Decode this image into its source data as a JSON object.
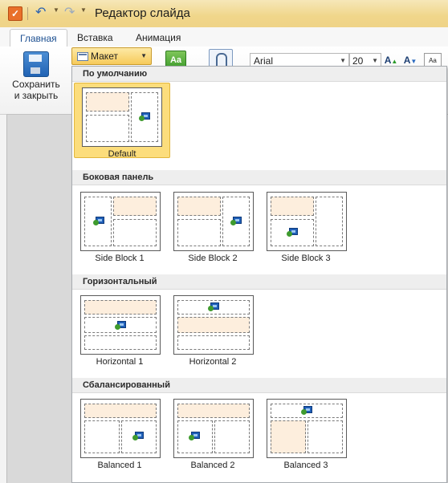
{
  "window": {
    "title": "Редактор слайда"
  },
  "tabs": [
    "Главная",
    "Вставка",
    "Анимация"
  ],
  "ribbon": {
    "save_label_1": "Сохранить",
    "save_label_2": "и закрыть",
    "layout_button": "Макет",
    "font": "Arial",
    "font_size": "20"
  },
  "sections": [
    {
      "title": "По умолчанию",
      "items": [
        {
          "label": "Default",
          "selected": true
        }
      ]
    },
    {
      "title": "Боковая панель",
      "items": [
        {
          "label": "Side Block 1"
        },
        {
          "label": "Side Block 2"
        },
        {
          "label": "Side Block 3"
        }
      ]
    },
    {
      "title": "Горизонтальный",
      "items": [
        {
          "label": "Horizontal 1"
        },
        {
          "label": "Horizontal 2"
        }
      ]
    },
    {
      "title": "Сбалансированный",
      "items": [
        {
          "label": "Balanced 1"
        },
        {
          "label": "Balanced 2"
        },
        {
          "label": "Balanced 3"
        }
      ]
    }
  ]
}
